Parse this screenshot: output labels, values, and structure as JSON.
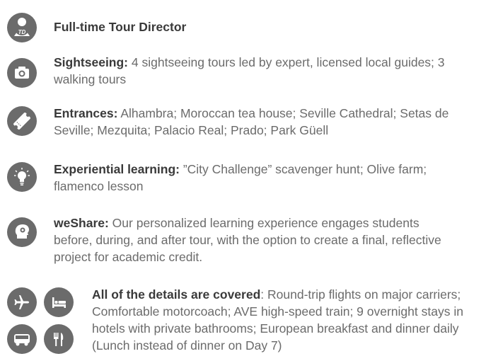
{
  "items": [
    {
      "icon": "tour-director-icon",
      "title": "Full-time Tour Director",
      "body": ""
    },
    {
      "icon": "camera-icon",
      "title": "Sightseeing:",
      "body": " 4 sightseeing tours led by expert, licensed local guides; 3 walking tours"
    },
    {
      "icon": "ticket-icon",
      "title": "Entrances:",
      "body": " Alhambra; Moroccan tea house; Seville Cathedral; Setas de Seville; Mezquita; Palacio Real; Prado; Park Güell"
    },
    {
      "icon": "lightbulb-icon",
      "title": "Experiential learning:",
      "body": " ”City Challenge” scavenger hunt; Olive farm; flamenco lesson"
    },
    {
      "icon": "head-icon",
      "title": "weShare:",
      "body": " Our personalized learning experience engages students before, during, and after tour, with the option to create a final, reflective project for academic credit."
    },
    {
      "icon": "details-icons",
      "title": "All of the details are covered",
      "body": ": Round-trip flights on major carriers; Comfortable motorcoach; AVE high-speed train; 9 overnight stays in hotels with private bathrooms; European breakfast and dinner daily (Lunch instead of dinner on Day 7)"
    }
  ],
  "icon_badge_text": "TD",
  "colors": {
    "icon_bg": "#6b6b6b",
    "title": "#3a3a3a",
    "body": "#6b6b6b"
  }
}
